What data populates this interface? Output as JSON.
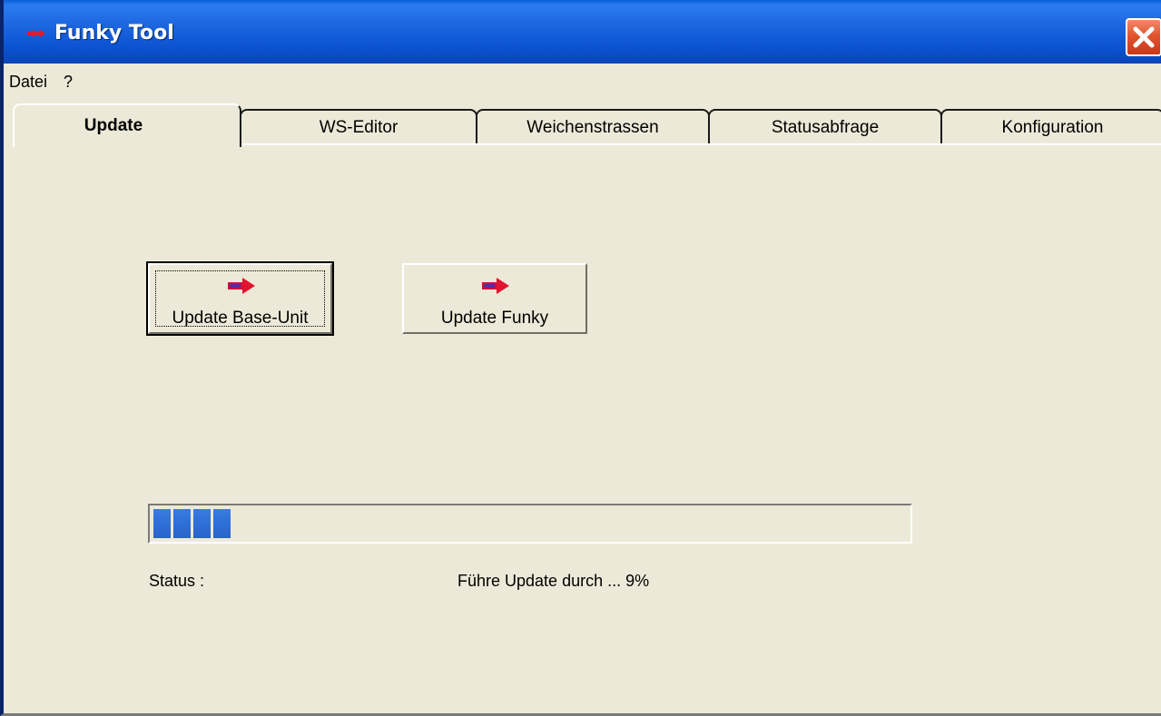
{
  "window": {
    "title": "Funky Tool",
    "icon": "red-arrow-icon",
    "close_icon": "close-icon"
  },
  "menu": {
    "items": [
      {
        "label": "Datei"
      },
      {
        "label": "?"
      }
    ]
  },
  "tabs": [
    {
      "label": "Update",
      "active": true
    },
    {
      "label": "WS-Editor",
      "active": false
    },
    {
      "label": "Weichenstrassen",
      "active": false
    },
    {
      "label": "Statusabfrage",
      "active": false
    },
    {
      "label": "Konfiguration",
      "active": false
    }
  ],
  "update_panel": {
    "buttons": [
      {
        "label": "Update Base-Unit",
        "icon": "funky-arrow-icon",
        "default": true
      },
      {
        "label": "Update Funky",
        "icon": "funky-arrow-icon",
        "default": false
      }
    ],
    "progress": {
      "blocks_filled": 4,
      "percent": 9
    },
    "status_label": "Status :",
    "status_value": "Führe Update durch ... 9%"
  },
  "colors": {
    "titlebar": "#0b53d0",
    "window_bg": "#ece9d8",
    "progress_fill": "#2e6fd8",
    "close_button": "#e2552e"
  }
}
